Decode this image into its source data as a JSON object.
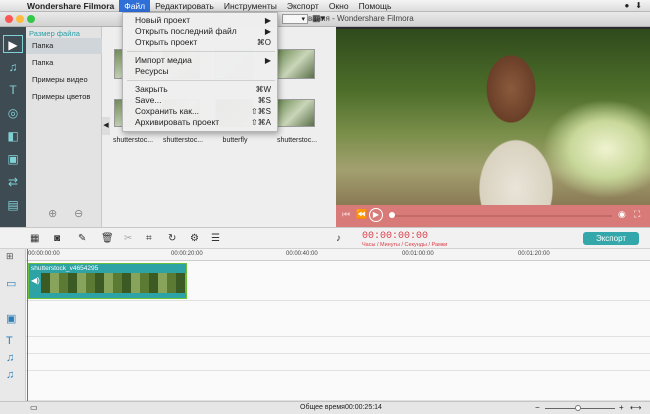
{
  "menubar": {
    "app": "Wondershare Filmora",
    "items": [
      "Файл",
      "Редактировать",
      "Инструменты",
      "Экспорт",
      "Окно",
      "Помощь"
    ]
  },
  "window": {
    "title": "азвания - Wondershare Filmora"
  },
  "file_menu": [
    {
      "label": "Новый проект",
      "shortcut": "▶"
    },
    {
      "label": "Открыть последний файл",
      "shortcut": "▶"
    },
    {
      "label": "Открыть проект",
      "shortcut": "⌘O"
    },
    {
      "label": "Импорт медиа",
      "shortcut": "▶"
    },
    {
      "label": "Ресурсы",
      "shortcut": ""
    },
    {
      "label": "Закрыть",
      "shortcut": "⌘W"
    },
    {
      "label": "Save...",
      "shortcut": "⌘S"
    },
    {
      "label": "Сохранить как...",
      "shortcut": "⇧⌘S"
    },
    {
      "label": "Архивировать проект",
      "shortcut": "⇧⌘A"
    }
  ],
  "library": {
    "header": "Размер файла",
    "items": [
      "Папка",
      "Папка",
      "Примеры видео",
      "Примеры цветов"
    ]
  },
  "media": {
    "captions": [
      "shutterstoc...",
      "shutterstoc...",
      "butterfly",
      "shutterstoc..."
    ]
  },
  "timeline": {
    "timecode": "00:00:00:00",
    "timecode_label": "Часы / Минуты / Секунды / Рамки",
    "export_label": "Экспорт",
    "ruler": [
      "00:00:00:00",
      "00:00:20:00",
      "00:00:40:00",
      "00:01:00:00",
      "00:01:20:00"
    ],
    "clip_name": "shutterstock_v4654295"
  },
  "status": {
    "total_time": "Общее время00:00:25:14"
  },
  "colors": {
    "accent": "#33a7a9",
    "timecode": "#d9404a",
    "preview_controls": "#d87b78"
  }
}
